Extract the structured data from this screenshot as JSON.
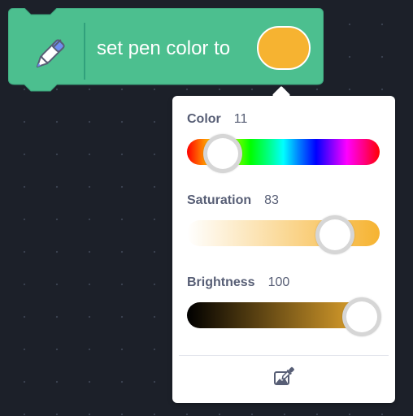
{
  "block": {
    "label": "set pen color to",
    "block_color": "#4cbf8f",
    "swatch_color": "#f6b331",
    "pen_icon": "pen-icon"
  },
  "color_picker": {
    "sliders": [
      {
        "id": "color",
        "label": "Color",
        "value": "11"
      },
      {
        "id": "saturation",
        "label": "Saturation",
        "value": "83"
      },
      {
        "id": "brightness",
        "label": "Brightness",
        "value": "100"
      }
    ],
    "eyedropper_icon": "eyedropper-icon"
  }
}
